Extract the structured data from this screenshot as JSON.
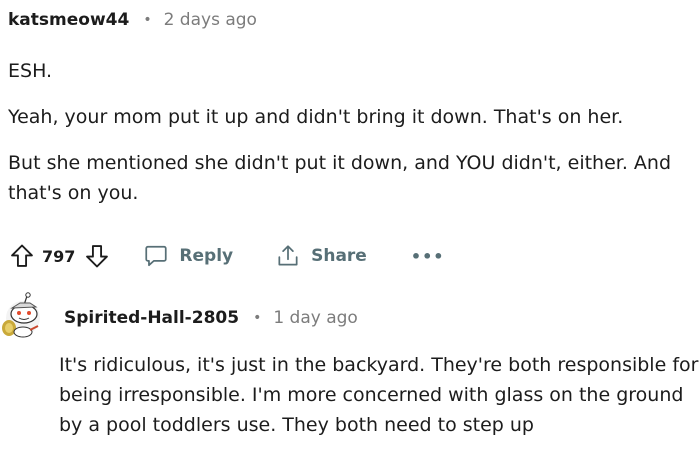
{
  "comment": {
    "username": "katsmeow44",
    "separator": "•",
    "time": "2 days ago",
    "paragraphs": [
      "ESH.",
      "Yeah, your mom put it up and didn't bring it down. That's on her.",
      "But she mentioned she didn't put it down, and YOU didn't, either. And that's on you."
    ],
    "score": "797",
    "reply_label": "Reply",
    "share_label": "Share",
    "more_label": "•••"
  },
  "reply": {
    "username": "Spirited-Hall-2805",
    "separator": "•",
    "time": "1 day ago",
    "text": "It's ridiculous, it's just in the backyard. They're both responsible for being irresponsible. I'm more concerned with glass on the ground by a pool toddlers use. They both need to step up"
  },
  "icons": {
    "upvote": "arrow-up-outline-icon",
    "downvote": "arrow-down-outline-icon",
    "reply": "speech-bubble-icon",
    "share": "share-upload-icon",
    "avatar": "snoo-avatar-icon"
  },
  "colors": {
    "text": "#1c1c1c",
    "meta": "#7c7c7c",
    "action": "#576f76"
  }
}
